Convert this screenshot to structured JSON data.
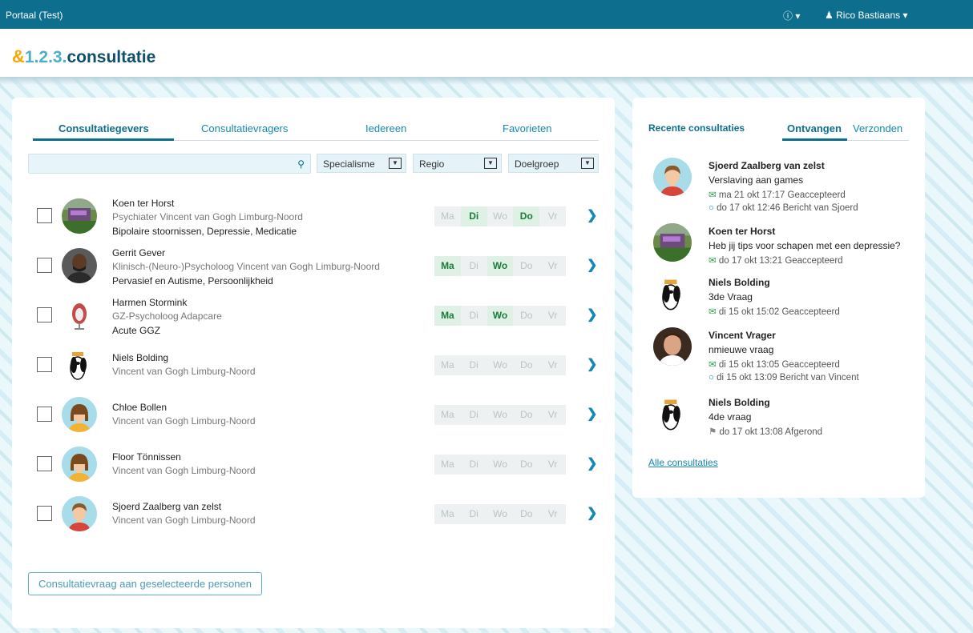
{
  "topbar": {
    "portal": "Portaal (Test)",
    "info_icon": "info-circle-icon",
    "user": "Rico Bastiaans"
  },
  "logo": {
    "amp": "&",
    "text_a": "1.2.3.",
    "text_b": "consultatie"
  },
  "tabs": [
    "Consultatiegevers",
    "Consultatievragers",
    "Iedereen",
    "Favorieten"
  ],
  "search": {
    "placeholder": ""
  },
  "filters": [
    "Specialisme",
    "Regio",
    "Doelgroep"
  ],
  "day_labels": [
    "Ma",
    "Di",
    "Wo",
    "Do",
    "Vr"
  ],
  "people": [
    {
      "name": "Koen ter Horst",
      "sub": "Psychiater Vincent van Gogh Limburg-Noord",
      "tags": "Bipolaire stoornissen, Depressie, Medicatie",
      "days": [
        false,
        true,
        false,
        true,
        false
      ],
      "avatar": "photo-bus"
    },
    {
      "name": "Gerrit Gever",
      "sub": "Klinisch-(Neuro-)Psycholoog Vincent van Gogh Limburg-Noord",
      "tags": "Pervasief en Autisme, Persoonlijkheid",
      "days": [
        true,
        false,
        true,
        false,
        false
      ],
      "avatar": "photo-man"
    },
    {
      "name": "Harmen Stormink",
      "sub": "GZ-Psycholoog Adapcare",
      "tags": "Acute GGZ",
      "days": [
        true,
        false,
        true,
        false,
        false
      ],
      "avatar": "photo-egg-chair"
    },
    {
      "name": "Niels Bolding",
      "sub": "Vincent van Gogh Limburg-Noord",
      "tags": "",
      "days": [
        false,
        false,
        false,
        false,
        false
      ],
      "avatar": "cartoon-dog"
    },
    {
      "name": "Chloe Bollen",
      "sub": "Vincent van Gogh Limburg-Noord",
      "tags": "",
      "days": [
        false,
        false,
        false,
        false,
        false
      ],
      "avatar": "default-female"
    },
    {
      "name": "Floor Tönnissen",
      "sub": "Vincent van Gogh Limburg-Noord",
      "tags": "",
      "days": [
        false,
        false,
        false,
        false,
        false
      ],
      "avatar": "default-female"
    },
    {
      "name": "Sjoerd Zaalberg van zelst",
      "sub": "Vincent van Gogh Limburg-Noord",
      "tags": "",
      "days": [
        false,
        false,
        false,
        false,
        false
      ],
      "avatar": "default-male"
    }
  ],
  "send_button": "Consultatievraag aan geselecteerde personen",
  "recent": {
    "title": "Recente consultaties",
    "tab_received": "Ontvangen",
    "tab_sent": "Verzonden",
    "items": [
      {
        "name": "Sjoerd Zaalberg van zelst",
        "question": "Verslaving aan games",
        "status1": "ma 21 okt 17:17 Geaccepteerd",
        "status2": "do 17 okt 12:46 Bericht van Sjoerd",
        "avatar": "default-male"
      },
      {
        "name": "Koen ter Horst",
        "question": "Heb jij tips voor schapen met een depressie?",
        "status1": "do 17 okt 13:21 Geaccepteerd",
        "status2": "",
        "avatar": "photo-bus"
      },
      {
        "name": "Niels Bolding",
        "question": "3de Vraag",
        "status1": "di 15 okt 15:02 Geaccepteerd",
        "status2": "",
        "avatar": "cartoon-dog"
      },
      {
        "name": "Vincent Vrager",
        "question": "nmieuwe vraag",
        "status1": "di 15 okt 13:05 Geaccepteerd",
        "status2": "di 15 okt 13:09 Bericht van Vincent",
        "avatar": "photo-man-2"
      },
      {
        "name": "Niels Bolding",
        "question": "4de vraag",
        "status1": "do 17 okt 13:08 Afgerond",
        "status2": "",
        "avatar": "cartoon-dog"
      }
    ],
    "all_link": "Alle consultaties"
  }
}
